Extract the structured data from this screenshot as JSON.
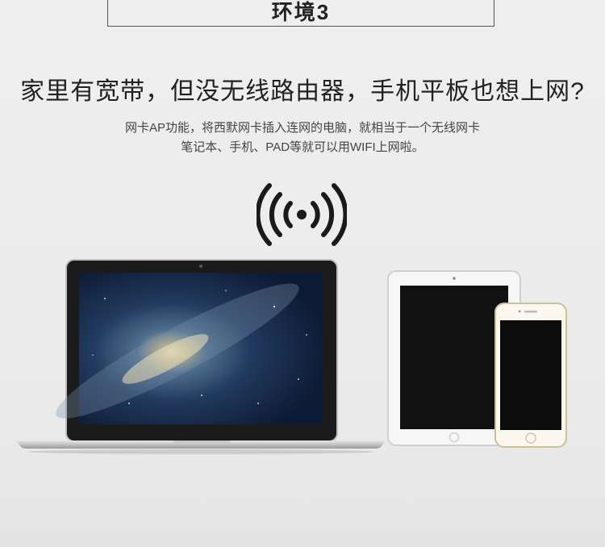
{
  "section_title": "环境3",
  "headline": "家里有宽带，但没无线路由器，手机平板也想上网?",
  "description": {
    "line1": "网卡AP功能，将西默网卡插入连网的电脑，就相当于一个无线网卡",
    "line2": "笔记本、手机、PAD等就可以用WIFI上网啦。"
  },
  "icons": {
    "wifi": "wifi-broadcast-icon",
    "laptop": "laptop-illustration",
    "tablet": "tablet-illustration",
    "phone": "smartphone-illustration"
  }
}
